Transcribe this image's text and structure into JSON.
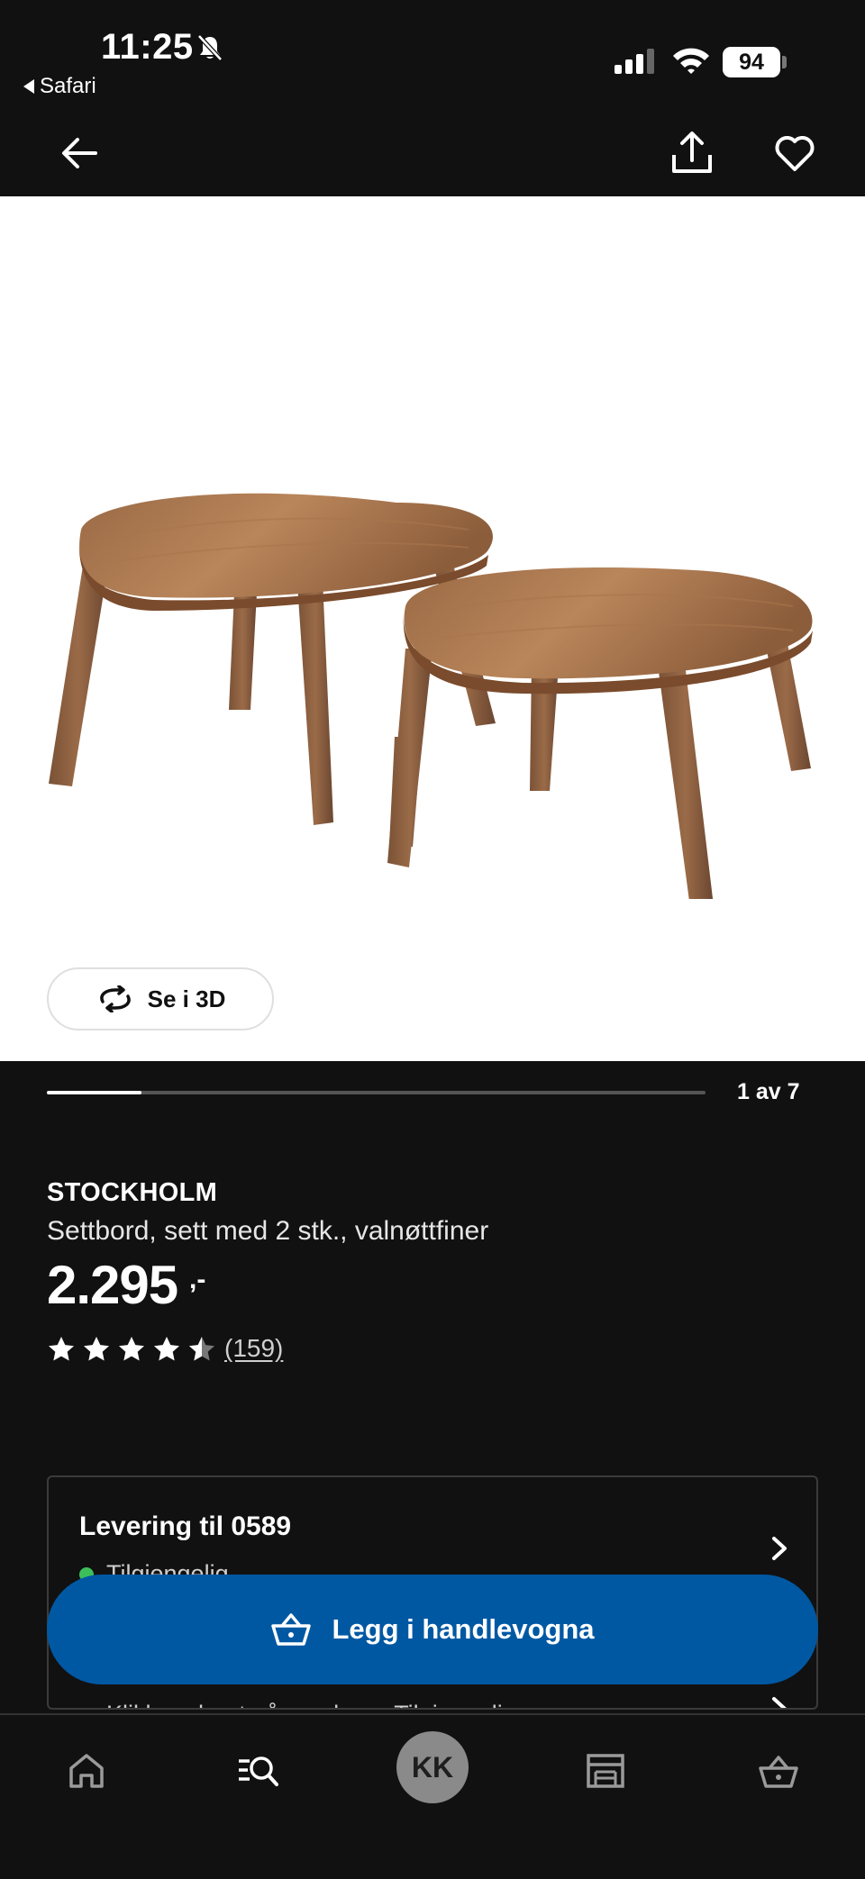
{
  "status_bar": {
    "time": "11:25",
    "back_app": "Safari",
    "battery": "94"
  },
  "nav": {
    "back_icon": "arrow-left-icon",
    "share_icon": "share-icon",
    "favorite_icon": "heart-icon"
  },
  "gallery": {
    "view_3d_label": "Se i 3D",
    "counter": "1 av 7",
    "progress_fraction": 0.143
  },
  "product": {
    "name": "STOCKHOLM",
    "description": "Settbord, sett med 2 stk., valnøttfiner",
    "price": "2.295",
    "price_suffix": ",-",
    "rating": 4.5,
    "review_count": "(159)"
  },
  "delivery": {
    "title": "Levering til 0589",
    "status": "Tilgjengelig",
    "pickup": "Klikk og hent på varehus - Tilgjengelig"
  },
  "cart_button": {
    "label": "Legg i handlevogna"
  },
  "tab_bar": {
    "avatar_initials": "KK",
    "tabs": [
      "home-icon",
      "search-icon",
      "profile-avatar",
      "store-icon",
      "cart-icon"
    ]
  },
  "colors": {
    "background": "#111111",
    "primary_button": "#0058a3",
    "available_dot": "#3cbf5b"
  }
}
